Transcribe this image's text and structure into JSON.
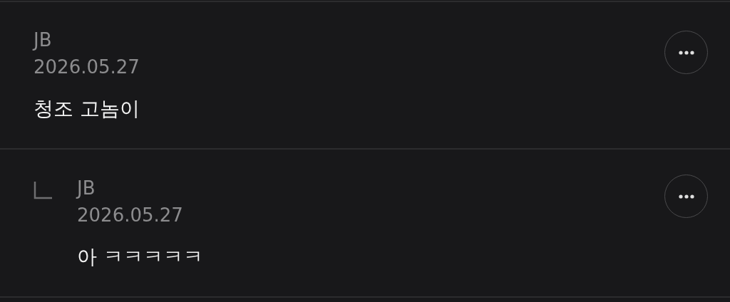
{
  "comments": [
    {
      "kind": "comment",
      "author": "JB",
      "date": "2026.05.27",
      "text": "청조 고놈이"
    },
    {
      "kind": "reply",
      "author": "JB",
      "date": "2026.05.27",
      "text": "아 ㅋㅋㅋㅋㅋ"
    }
  ]
}
